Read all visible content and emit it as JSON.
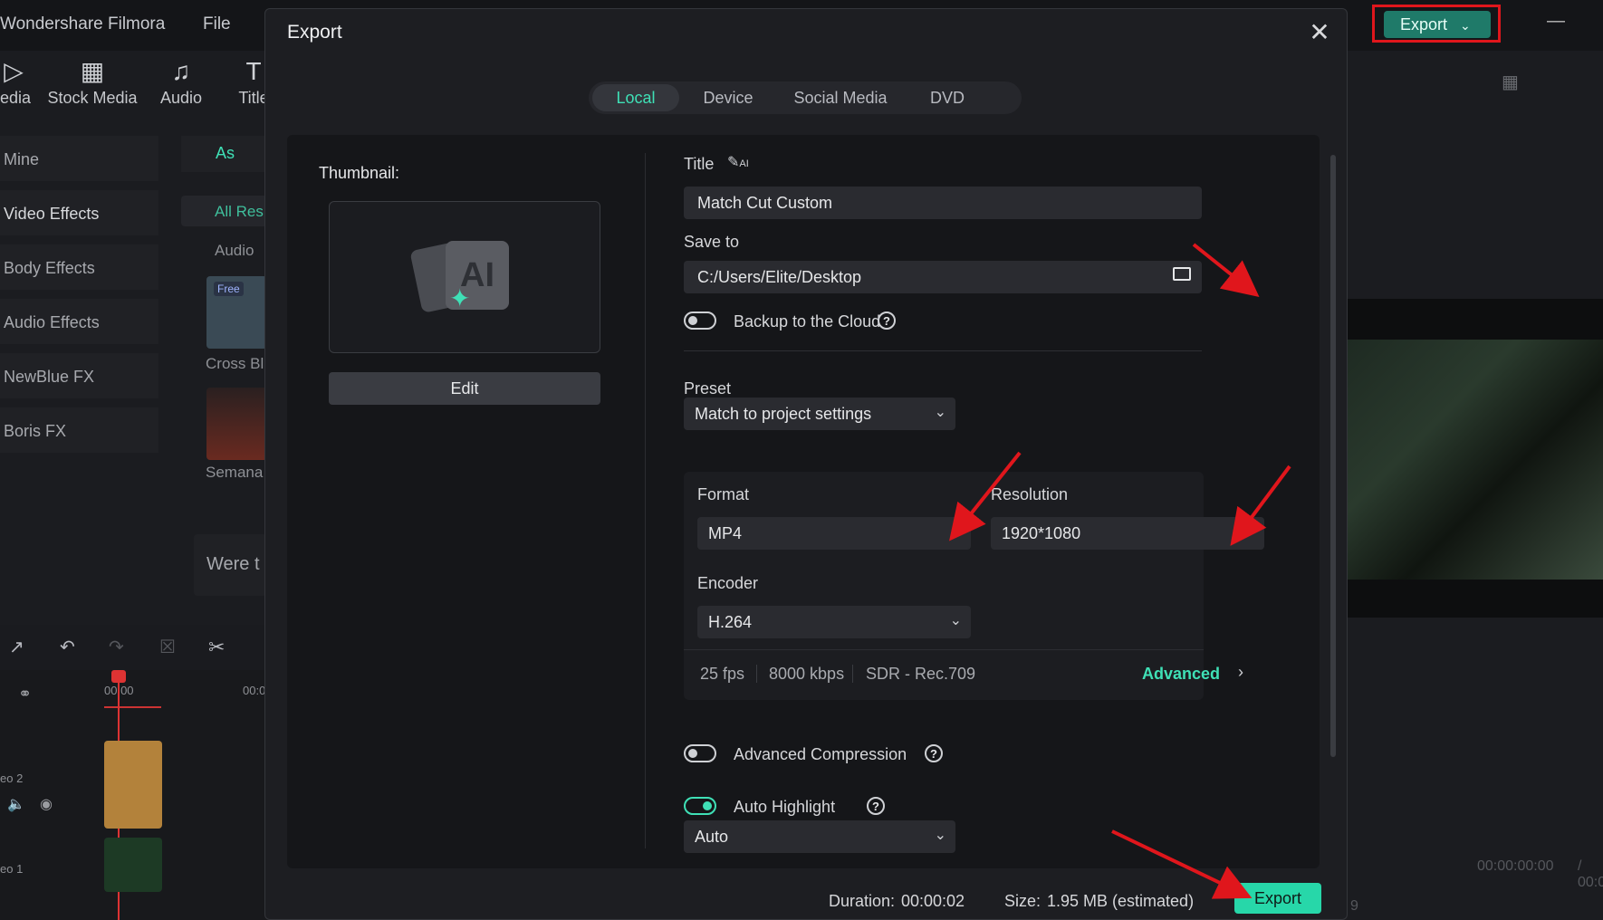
{
  "app": {
    "name": "Wondershare Filmora",
    "menu_file": "File",
    "export_label": "Export"
  },
  "toolbar": {
    "media": "edia",
    "stock_media": "Stock Media",
    "audio": "Audio",
    "titles": "Title"
  },
  "sidebar": {
    "items": [
      "Mine",
      "Video Effects",
      "Body Effects",
      "Audio Effects",
      "NewBlue FX",
      "Boris FX"
    ]
  },
  "middle": {
    "tab_assets": "As",
    "filter_all": "All Res",
    "filter_audio": "Audio",
    "free_badge": "Free",
    "item1": "Cross Bl",
    "item2": "Semana",
    "prompt": "Were t"
  },
  "timeline": {
    "time0": "00:00",
    "time1": "00:0",
    "track2": "eo 2",
    "track1": "eo 1"
  },
  "preview": {
    "time_display": "00:00:00:00",
    "time_sep": "/ 00:0",
    "fps": "9"
  },
  "dialog": {
    "title": "Export",
    "tabs": [
      "Local",
      "Device",
      "Social Media",
      "DVD"
    ],
    "active_tab": "Local",
    "thumbnail_label": "Thumbnail:",
    "thumbnail_ai_text": "AI",
    "edit_label": "Edit",
    "title_label": "Title",
    "title_ai_badge": "AI",
    "title_value": "Match Cut Custom",
    "save_to_label": "Save to",
    "save_to_value": "C:/Users/Elite/Desktop",
    "backup_label": "Backup to the Cloud",
    "preset_label": "Preset",
    "preset_value": "Match to project settings",
    "format_label": "Format",
    "format_value": "MP4",
    "resolution_label": "Resolution",
    "resolution_value": "1920*1080",
    "encoder_label": "Encoder",
    "encoder_value": "H.264",
    "fps": "25 fps",
    "bitrate": "8000 kbps",
    "color_space": "SDR - Rec.709",
    "advanced_label": "Advanced",
    "adv_compression_label": "Advanced Compression",
    "auto_highlight_label": "Auto Highlight",
    "auto_highlight_value": "Auto",
    "duration_label": "Duration:",
    "duration_value": "00:00:02",
    "size_label": "Size:",
    "size_value": "1.95 MB (estimated)",
    "export_button": "Export"
  },
  "colors": {
    "accent": "#3fe0b6",
    "export_button": "#27d7a9",
    "highlight_box": "#e0161c",
    "annotation_arrow": "#e0161c"
  },
  "icons": [
    "close-icon",
    "folder-icon",
    "help-icon",
    "chevron-down-icon",
    "chevron-right-icon",
    "ai-pen-icon",
    "ai-image-icon"
  ]
}
